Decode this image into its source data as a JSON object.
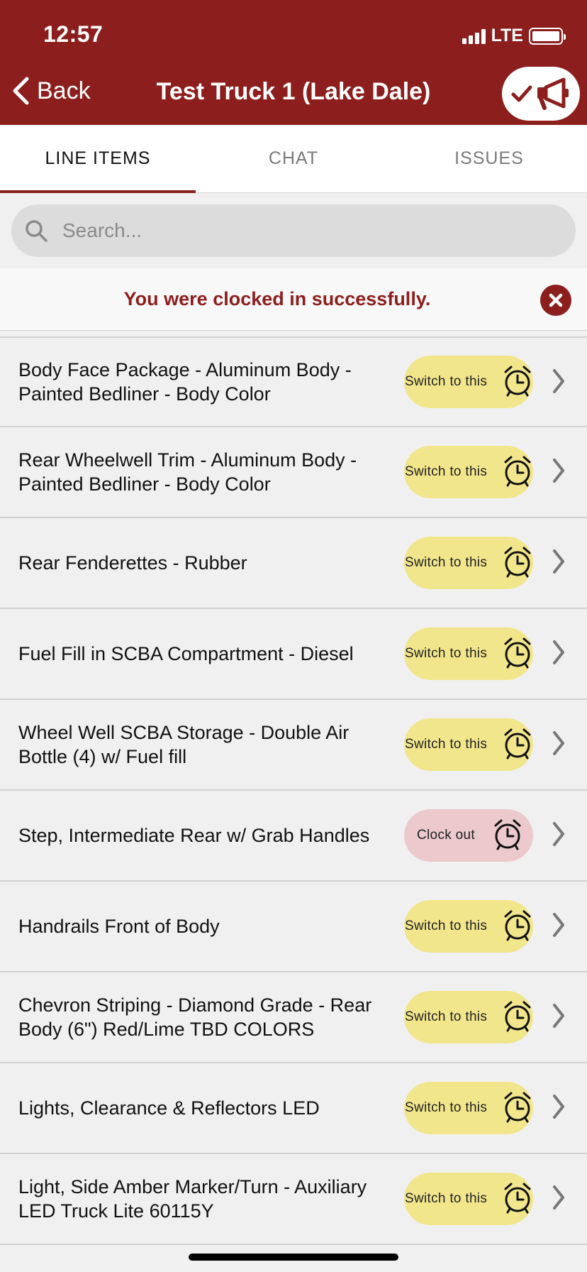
{
  "status_bar": {
    "time": "12:57",
    "network": "LTE"
  },
  "nav": {
    "back_label": "Back",
    "title": "Test Truck 1 (Lake Dale)"
  },
  "tabs": [
    {
      "label": "LINE ITEMS",
      "active": true
    },
    {
      "label": "CHAT",
      "active": false
    },
    {
      "label": "ISSUES",
      "active": false
    }
  ],
  "search": {
    "placeholder": "Search...",
    "value": ""
  },
  "banner": {
    "message": "You were clocked in successfully."
  },
  "items": [
    {
      "title": "Body Face Package - Aluminum Body - Painted Bedliner - Body Color",
      "action": "Switch to this"
    },
    {
      "title": "Rear Wheelwell Trim - Aluminum Body - Painted Bedliner - Body Color",
      "action": "Switch to this"
    },
    {
      "title": "Rear Fenderettes - Rubber",
      "action": "Switch to this"
    },
    {
      "title": "Fuel Fill in SCBA Compartment  - Diesel",
      "action": "Switch to this"
    },
    {
      "title": "Wheel Well SCBA Storage - Double Air Bottle (4) w/ Fuel fill",
      "action": "Switch to this"
    },
    {
      "title": "Step, Intermediate Rear  w/ Grab Handles",
      "action": "Clock out"
    },
    {
      "title": "Handrails Front of Body",
      "action": "Switch to this"
    },
    {
      "title": "Chevron Striping - Diamond Grade - Rear Body (6\")  Red/Lime  TBD COLORS",
      "action": "Switch to this"
    },
    {
      "title": "Lights, Clearance & Reflectors LED",
      "action": "Switch to this"
    },
    {
      "title": "Light, Side Amber Marker/Turn - Auxiliary LED  Truck Lite    60115Y",
      "action": "Switch to this"
    }
  ],
  "colors": {
    "brand": "#8c1f1d",
    "switch_pill": "#f2e68c",
    "clockout_pill": "#ebc9cc"
  }
}
